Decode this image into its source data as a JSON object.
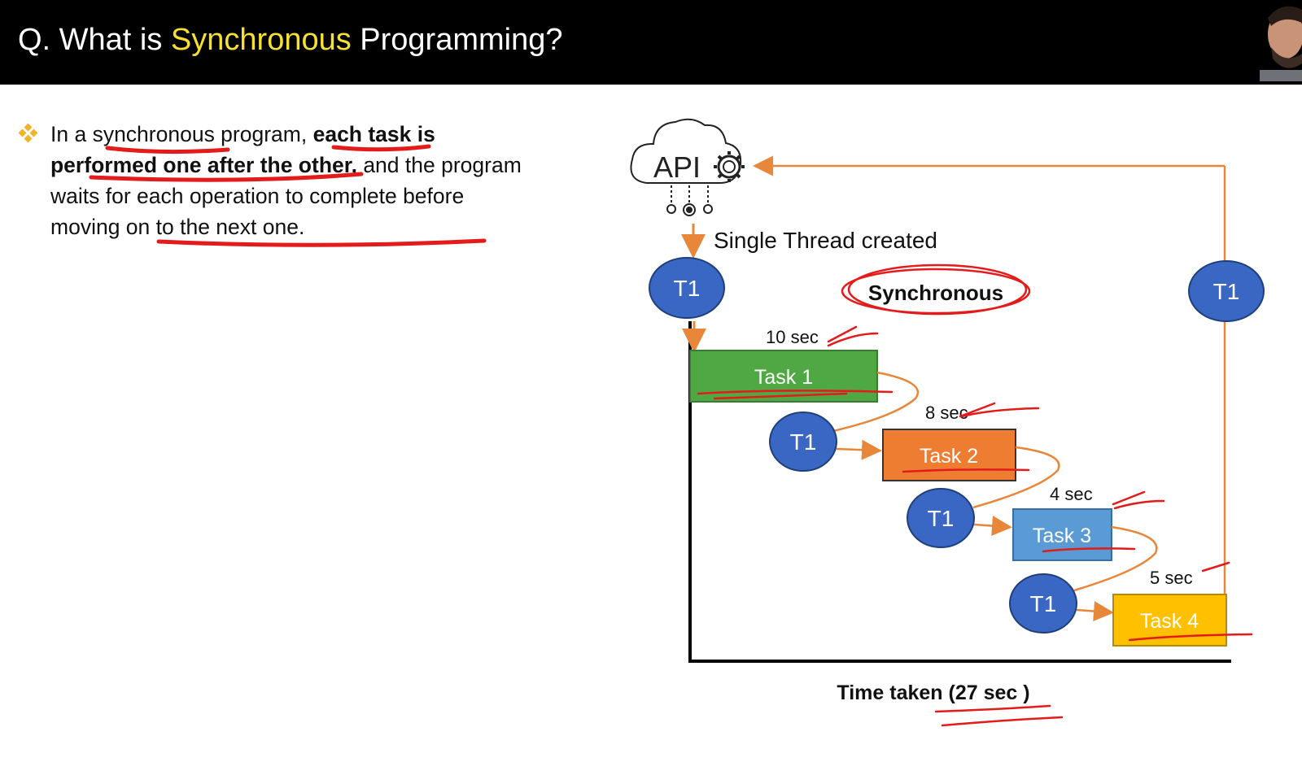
{
  "header": {
    "title_prefix": "Q. What is ",
    "title_highlight": "Synchronous",
    "title_suffix": " Programming?"
  },
  "bullet": {
    "part1": "In a synchronous program, ",
    "part2_bold": "each task is performed one after the other,",
    "part3": " and the program waits for each operation to complete before moving on to the next one."
  },
  "diagram": {
    "api_label": "API",
    "thread_caption": "Single Thread created",
    "sync_label": "Synchronous",
    "thread_name": "T1",
    "tasks": [
      {
        "name": "Task 1",
        "duration": "10 sec",
        "color": "#4fa843"
      },
      {
        "name": "Task 2",
        "duration": "8 sec",
        "color": "#ee7d31"
      },
      {
        "name": "Task 3",
        "duration": "4 sec",
        "color": "#5b9bd5"
      },
      {
        "name": "Task 4",
        "duration": "5 sec",
        "color": "#ffc000"
      }
    ],
    "time_taken": "Time taken (27 sec )"
  },
  "colors": {
    "header_bg": "#000000",
    "title_highlight": "#f5e12e",
    "thread_circle": "#3a67c4",
    "arrow": "#e8873a",
    "annotation": "#e31b1b"
  }
}
